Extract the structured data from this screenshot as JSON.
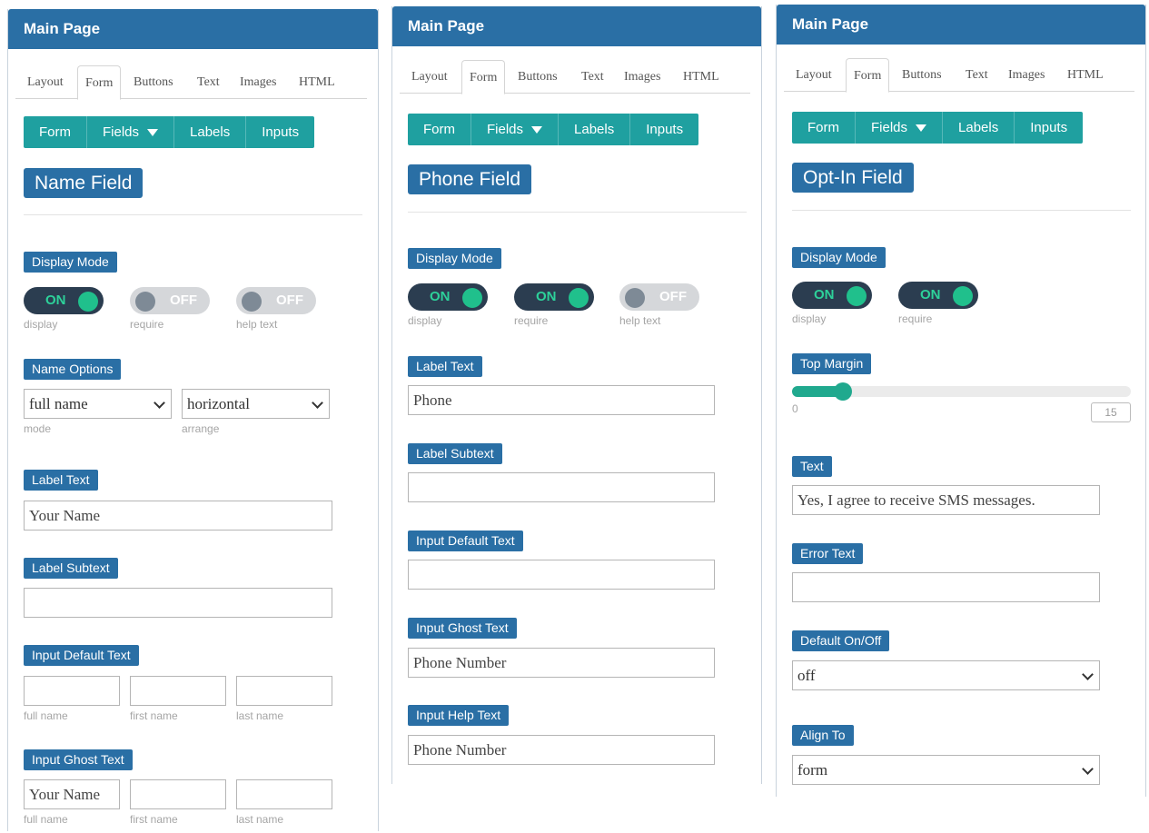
{
  "panels": [
    {
      "header": "Main Page",
      "tabs": [
        "Layout",
        "Form",
        "Buttons",
        "Text",
        "Images",
        "HTML"
      ],
      "active_tab": "Form",
      "subnav": [
        "Form",
        "Fields",
        "Labels",
        "Inputs"
      ],
      "field_title": "Name Field",
      "display_mode": {
        "label": "Display Mode",
        "toggles": [
          {
            "state": "ON",
            "caption": "display"
          },
          {
            "state": "OFF",
            "caption": "require"
          },
          {
            "state": "OFF",
            "caption": "help text"
          }
        ]
      },
      "name_options": {
        "label": "Name Options",
        "mode_value": "full name",
        "mode_caption": "mode",
        "arrange_value": "horizontal",
        "arrange_caption": "arrange"
      },
      "label_text": {
        "label": "Label Text",
        "value": "Your Name"
      },
      "label_subtext": {
        "label": "Label Subtext",
        "value": ""
      },
      "input_default_text": {
        "label": "Input Default Text",
        "values": [
          "",
          "",
          ""
        ],
        "captions": [
          "full name",
          "first name",
          "last name"
        ]
      },
      "input_ghost_text": {
        "label": "Input Ghost Text",
        "values": [
          "Your Name",
          "",
          ""
        ],
        "captions": [
          "full name",
          "first name",
          "last name"
        ]
      }
    },
    {
      "header": "Main Page",
      "tabs": [
        "Layout",
        "Form",
        "Buttons",
        "Text",
        "Images",
        "HTML"
      ],
      "active_tab": "Form",
      "subnav": [
        "Form",
        "Fields",
        "Labels",
        "Inputs"
      ],
      "field_title": "Phone Field",
      "display_mode": {
        "label": "Display Mode",
        "toggles": [
          {
            "state": "ON",
            "caption": "display"
          },
          {
            "state": "ON",
            "caption": "require"
          },
          {
            "state": "OFF",
            "caption": "help text"
          }
        ]
      },
      "label_text": {
        "label": "Label Text",
        "value": "Phone"
      },
      "label_subtext": {
        "label": "Label Subtext",
        "value": ""
      },
      "input_default_text": {
        "label": "Input Default Text",
        "value": ""
      },
      "input_ghost_text": {
        "label": "Input Ghost Text",
        "value": "Phone Number"
      },
      "input_help_text": {
        "label": "Input Help Text",
        "value": "Phone Number"
      }
    },
    {
      "header": "Main Page",
      "tabs": [
        "Layout",
        "Form",
        "Buttons",
        "Text",
        "Images",
        "HTML"
      ],
      "active_tab": "Form",
      "subnav": [
        "Form",
        "Fields",
        "Labels",
        "Inputs"
      ],
      "field_title": "Opt-In Field",
      "display_mode": {
        "label": "Display Mode",
        "toggles": [
          {
            "state": "ON",
            "caption": "display"
          },
          {
            "state": "ON",
            "caption": "require"
          }
        ]
      },
      "top_margin": {
        "label": "Top Margin",
        "min_label": "0",
        "value": 15,
        "value_label": "15"
      },
      "text": {
        "label": "Text",
        "value": "Yes, I agree to receive SMS messages."
      },
      "error_text": {
        "label": "Error Text",
        "value": ""
      },
      "default_on_off": {
        "label": "Default On/Off",
        "value": "off"
      },
      "align_to": {
        "label": "Align To",
        "value": "form"
      }
    }
  ]
}
